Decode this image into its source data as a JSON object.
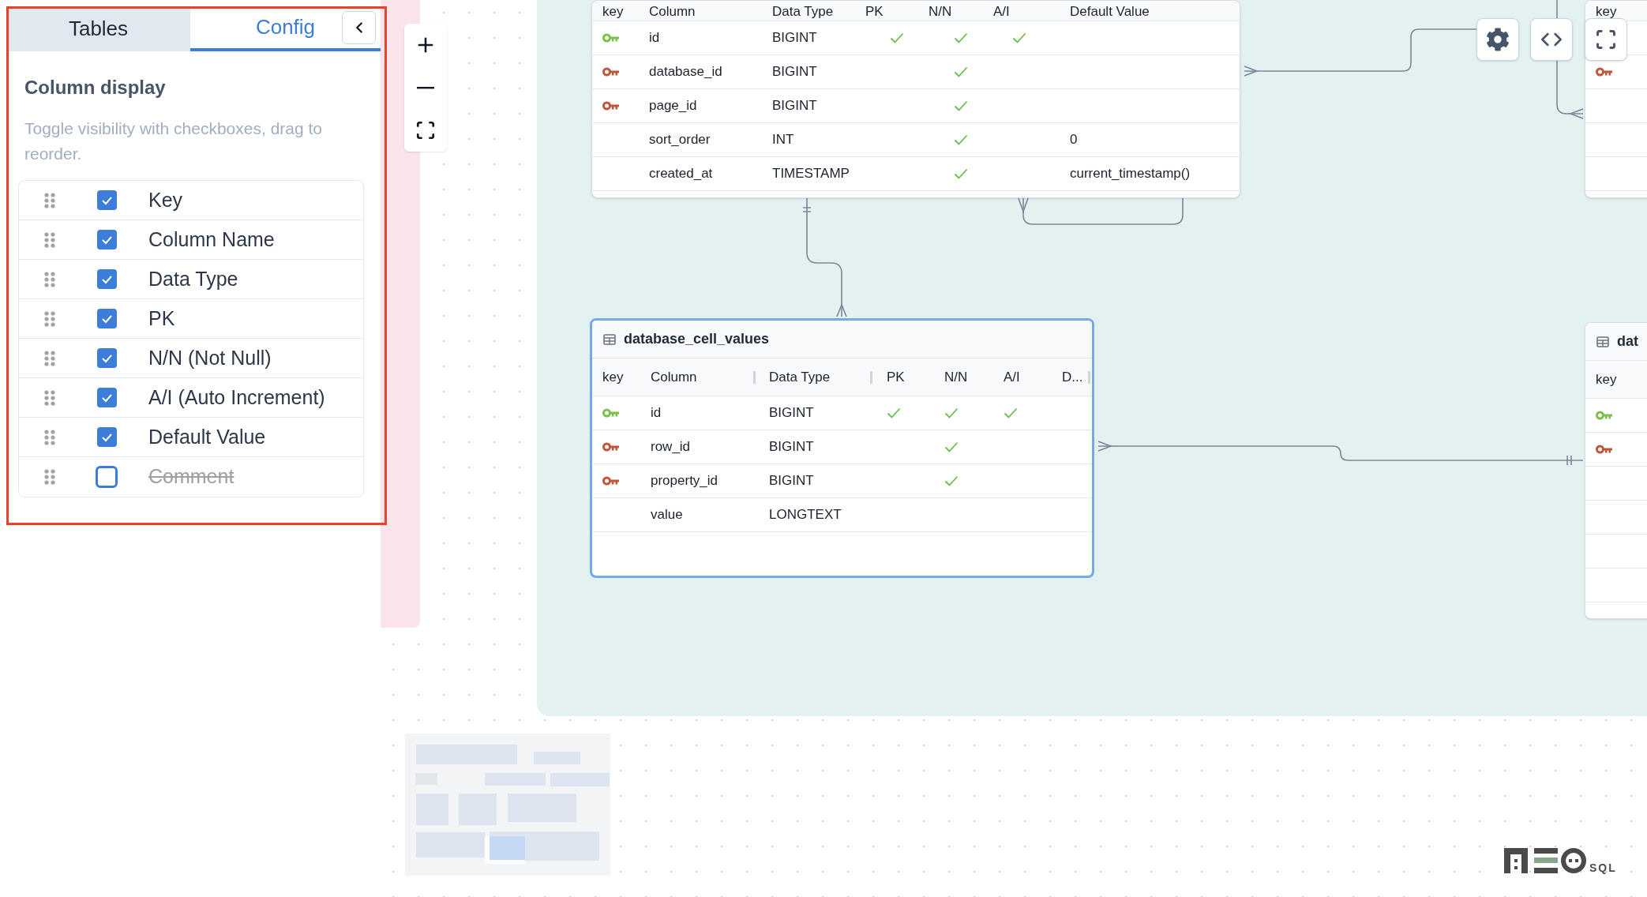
{
  "sidebar": {
    "tabs": [
      {
        "label": "Tables",
        "selected": false
      },
      {
        "label": "Config",
        "selected": true
      }
    ],
    "section_title": "Column display",
    "description": "Toggle visibility with checkboxes, drag to reorder.",
    "columns": [
      {
        "label": "Key",
        "checked": true
      },
      {
        "label": "Column Name",
        "checked": true
      },
      {
        "label": "Data Type",
        "checked": true
      },
      {
        "label": "PK",
        "checked": true
      },
      {
        "label": "N/N (Not Null)",
        "checked": true
      },
      {
        "label": "A/I (Auto Increment)",
        "checked": true
      },
      {
        "label": "Default Value",
        "checked": true
      },
      {
        "label": "Comment",
        "checked": false
      }
    ]
  },
  "canvas": {
    "tables": [
      {
        "selected": false,
        "columns": [
          "key",
          "Column",
          "Data Type",
          "PK",
          "N/N",
          "A/I",
          "Default Value"
        ],
        "rows": [
          {
            "kind": "primary",
            "name": "id",
            "type": "BIGINT",
            "pk": true,
            "nn": true,
            "ai": true
          },
          {
            "kind": "foreign",
            "name": "database_id",
            "type": "BIGINT",
            "pk": false,
            "nn": true,
            "ai": false
          },
          {
            "kind": "foreign",
            "name": "page_id",
            "type": "BIGINT",
            "pk": false,
            "nn": true,
            "ai": false
          },
          {
            "kind": "none",
            "name": "sort_order",
            "type": "INT",
            "pk": false,
            "nn": true,
            "ai": false,
            "default": "0"
          },
          {
            "kind": "none",
            "name": "created_at",
            "type": "TIMESTAMP",
            "pk": false,
            "nn": true,
            "ai": false,
            "default": "current_timestamp()"
          }
        ]
      },
      {
        "title": "database_cell_values",
        "selected": true,
        "columns": [
          "key",
          "Column",
          "Data Type",
          "PK",
          "N/N",
          "A/I",
          "D..."
        ],
        "rows": [
          {
            "kind": "primary",
            "name": "id",
            "type": "BIGINT",
            "pk": true,
            "nn": true,
            "ai": true
          },
          {
            "kind": "foreign",
            "name": "row_id",
            "type": "BIGINT",
            "pk": false,
            "nn": true,
            "ai": false
          },
          {
            "kind": "foreign",
            "name": "property_id",
            "type": "BIGINT",
            "pk": false,
            "nn": true,
            "ai": false
          },
          {
            "kind": "none",
            "name": "value",
            "type": "LONGTEXT",
            "pk": false,
            "nn": false,
            "ai": false
          }
        ]
      },
      {
        "selected": false,
        "columns": [
          "key"
        ],
        "rows": [
          {
            "kind": "none"
          },
          {
            "kind": "foreign"
          },
          {
            "kind": "none"
          },
          {
            "kind": "none"
          },
          {
            "kind": "none"
          }
        ]
      },
      {
        "title": "dat",
        "selected": false,
        "columns": [
          "key"
        ],
        "rows": [
          {
            "kind": "primary"
          },
          {
            "kind": "foreign"
          },
          {
            "kind": "none"
          },
          {
            "kind": "none"
          },
          {
            "kind": "none"
          },
          {
            "kind": "none"
          }
        ]
      }
    ]
  },
  "logo": {
    "suffix": "SQL"
  }
}
